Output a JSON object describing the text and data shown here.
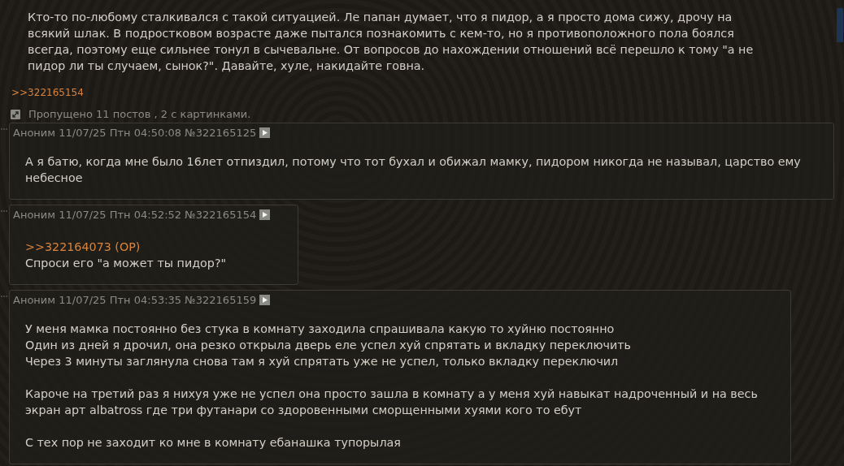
{
  "op_post": {
    "lines": [
      "Кто-то по-любому сталкивался с такой ситуацией. Ле папан думает, что я пидор, а я просто дома сижу, дрочу на",
      "всякий шлак. В подростковом возрасте даже пытался познакомить с кем-то, но я противоположного пола боялся",
      "всегда, поэтому еще сильнее тонул в сычевальне. От вопросов до нахождении отношений всё перешло к тому \"а не",
      "пидор ли ты случаем, сынок?\". Давайте, хуле, накидайте говна."
    ],
    "replies": [
      ">>322165154"
    ]
  },
  "omitted": {
    "text": "Пропущено 11 постов , 2 с картинками."
  },
  "posts": [
    {
      "header": "Аноним 11/07/25 Птн 04:50:08 №322165125",
      "paragraphs": [
        [
          "А я батю, когда мне было 16лет отпиздил, потому что тот бухал и обижал мамку, пидором никогда не называл, царство ему",
          "небесное"
        ]
      ]
    },
    {
      "header": "Аноним 11/07/25 Птн 04:52:52 №322165154",
      "quote": ">>322164073 (OP)",
      "paragraphs": [
        [
          "Спроси его \"а может ты пидор?\""
        ]
      ]
    },
    {
      "header": "Аноним 11/07/25 Птн 04:53:35 №322165159",
      "paragraphs": [
        [
          "У меня мамка постоянно без стука в комнату заходила спрашивала какую то хуйню постоянно",
          "Один из дней я дрочил, она резко открыла дверь еле успел хуй спрятать и вкладку переключить",
          "Через 3 минуты заглянула снова там я хуй спрятать уже не успел, только вкладку переключил"
        ],
        [
          "Кароче на третий раз я нихуя уже не успел она просто зашла в комнату а у меня хуй навыкат надроченный и на весь",
          "экран арт albatross где три футанари со здоровенными сморщенными хуями кого то ебут"
        ],
        [
          "С тех пор не заходит ко мне в комнату ебанашка тупорылая"
        ]
      ]
    }
  ]
}
